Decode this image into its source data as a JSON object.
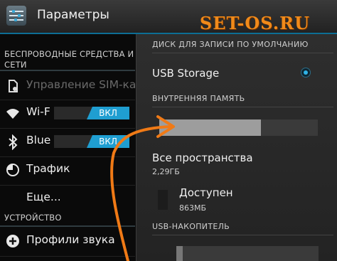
{
  "header": {
    "title": "Параметры",
    "watermark": "SET-OS.RU"
  },
  "sidebar": {
    "sections": [
      {
        "title_line1": "БЕСПРОВОДНЫЕ СРЕДСТВА И",
        "title_line2": "СЕТИ"
      },
      {
        "title": "УСТРОЙСТВО"
      }
    ],
    "items": [
      {
        "icon": "sim-card-icon",
        "label": "Управление SIM-ка",
        "enabled": false
      },
      {
        "icon": "wifi-icon",
        "label": "Wi-F",
        "toggle": "ВКЛ"
      },
      {
        "icon": "bluetooth-icon",
        "label": "Blue",
        "toggle": "ВКЛ"
      },
      {
        "icon": "data-usage-icon",
        "label": "Трафик"
      },
      {
        "icon": "",
        "label": "Еще..."
      },
      {
        "icon": "sound-profile-icon",
        "label": "Профили звука"
      }
    ]
  },
  "panel": {
    "default_disk_header": "ДИСК ДЛЯ ЗАПИСИ ПО УМОЛЧАНИЮ",
    "usb_storage_option": "USB Storage",
    "usb_storage_selected": true,
    "internal_header": "ВНУТРЕННЯЯ ПАМЯТЬ",
    "internal_used_fraction": 0.64,
    "all_space_label": "Все пространства",
    "all_space_value": "2,29ГБ",
    "available_label": "Доступен",
    "available_value": "863МБ",
    "usb_drive_header": "USB-НАКОПИТЕЛЬ"
  },
  "colors": {
    "accent": "#1f9ed1",
    "annotation_arrow": "#f07a16",
    "watermark": "#f08a1a"
  }
}
